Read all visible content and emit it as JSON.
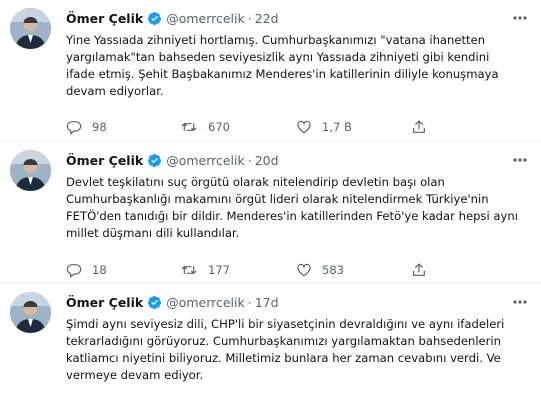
{
  "tweets": [
    {
      "name": "Ömer Çelik",
      "handle": "@omerrcelik",
      "separator": "·",
      "time": "22d",
      "text": "Yine Yassıada zihniyeti hortlamış. Cumhurbaşkanımızı \"vatana ihanetten yargılamak\"tan bahseden seviyesizlik aynı Yassıada zihniyeti gibi kendini ifade etmiş. Şehit Başbakanımız Menderes'in katillerinin diliyle konuşmaya devam ediyorlar.",
      "replies": "98",
      "retweets": "670",
      "likes": "1,7 B"
    },
    {
      "name": "Ömer Çelik",
      "handle": "@omerrcelik",
      "separator": "·",
      "time": "20d",
      "text": "Devlet teşkilatını suç örgütü olarak nitelendirip devletin başı olan Cumhurbaşkanlığı makamını örgüt lideri olarak nitelendirmek Türkiye'nin FETÖ'den tanıdığı bir dildir. Menderes'in katillerinden Fetö'ye kadar hepsi aynı millet düşmanı dili kullandılar.",
      "replies": "18",
      "retweets": "177",
      "likes": "583"
    },
    {
      "name": "Ömer Çelik",
      "handle": "@omerrcelik",
      "separator": "·",
      "time": "17d",
      "text": "Şimdi aynı seviyesiz dili, CHP'li bir siyasetçinin devraldığını ve aynı ifadeleri tekrarladığını görüyoruz. Cumhurbaşkanımızı yargılamaktan bahsedenlerin katliamcı niyetini biliyoruz. Milletimiz bunlara her zaman cevabını verdi. Ve vermeye devam ediyor."
    }
  ],
  "colors": {
    "verified": "#1d9bf0",
    "secondary_text": "#536471",
    "divider": "#eff3f4"
  },
  "icons": {
    "reply": "reply-icon",
    "retweet": "retweet-icon",
    "like": "heart-icon",
    "share": "share-icon",
    "more": "more-icon",
    "verified": "verified-badge-icon"
  }
}
